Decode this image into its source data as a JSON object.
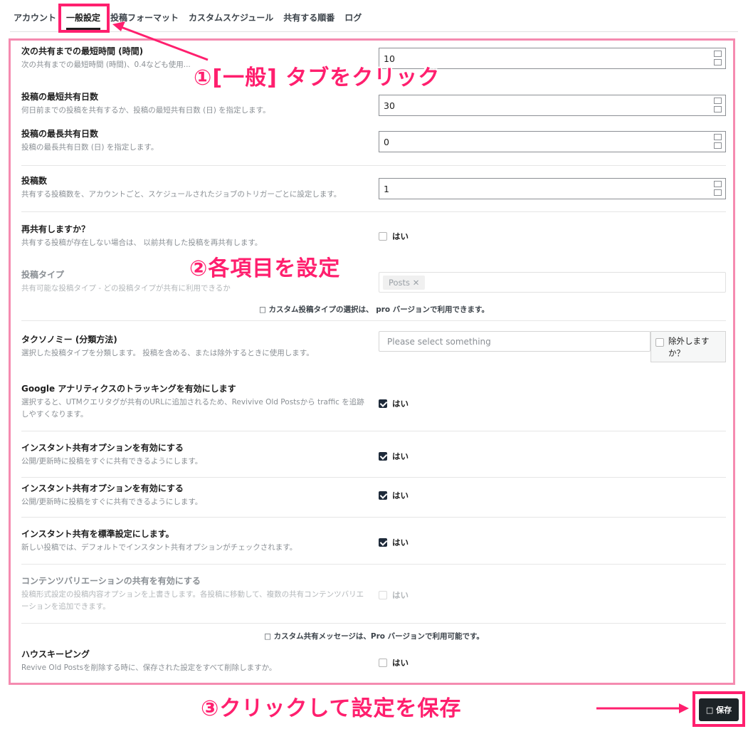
{
  "tabs": [
    {
      "label": "アカウント",
      "active": false
    },
    {
      "label": "一般設定",
      "active": true
    },
    {
      "label": "投稿フォーマット",
      "active": false
    },
    {
      "label": "カスタムスケジュール",
      "active": false
    },
    {
      "label": "共有する順番",
      "active": false
    },
    {
      "label": "ログ",
      "active": false
    }
  ],
  "annotations": {
    "step1": "①[一般] タブをクリック",
    "step2": "②各項目を設定",
    "step3": "③クリックして設定を保存",
    "color": "#ff1f6e",
    "frame_color": "#f58bb0"
  },
  "settings": {
    "min_interval": {
      "label": "次の共有までの最短時間 (時間)",
      "desc": "次の共有までの最短時間 (時間)、0.4なども使用...",
      "value": "10"
    },
    "min_age": {
      "label": "投稿の最短共有日数",
      "desc": "何日前までの投稿を共有するか、投稿の最短共有日数 (日) を指定します。",
      "value": "30"
    },
    "max_age": {
      "label": "投稿の最長共有日数",
      "desc": "投稿の最長共有日数 (日) を指定します。",
      "value": "0"
    },
    "post_count": {
      "label": "投稿数",
      "desc": "共有する投稿数を、アカウントごと、スケジュールされたジョブのトリガーごとに設定します。",
      "value": "1"
    },
    "reshare": {
      "label": "再共有しますか？",
      "desc": "共有する投稿が存在しない場合は、 以前共有した投稿を再共有します。",
      "option": "はい",
      "checked": false
    },
    "post_type": {
      "label": "投稿タイプ",
      "desc": "共有可能な投稿タイプ - どの投稿タイプが共有に利用できるか",
      "chip": "Posts ✕"
    },
    "post_type_note": "□ カスタム投稿タイプの選択は、 pro バージョンで利用できます。",
    "taxonomy": {
      "label": "タクソノミー (分類方法)",
      "desc": "選択した投稿タイプを分類します。 投稿を含める、または除外するときに使用します。",
      "placeholder": "Please select something",
      "exclude": "除外しますか？"
    },
    "ga_tracking": {
      "label": "Google アナリティクスのトラッキングを有効にします",
      "desc": "選択すると、UTMクエリタグが共有のURLに追加されるため、Revivive Old Postsから traffic を追跡しやすくなります。",
      "option": "はい",
      "checked": true
    },
    "instant_share_1": {
      "label": "インスタント共有オプションを有効にする",
      "desc": "公開/更新時に投稿をすぐに共有できるようにします。",
      "option": "はい",
      "checked": true
    },
    "instant_share_2": {
      "label": "インスタント共有オプションを有効にする",
      "desc": "公開/更新時に投稿をすぐに共有できるようにします。",
      "option": "はい",
      "checked": true
    },
    "instant_default": {
      "label": "インスタント共有を標準設定にします。",
      "desc": "新しい投稿では、デフォルトでインスタント共有オプションがチェックされます。",
      "option": "はい",
      "checked": true
    },
    "content_variation": {
      "label": "コンテンツバリエーションの共有を有効にする",
      "desc": "投稿形式設定の投稿内容オプションを上書きします。各投稿に移動して、複数の共有コンテンツバリエーションを追加できます。",
      "option": "はい",
      "checked": false
    },
    "custom_message_note": "□ カスタム共有メッセージは、Pro バージョンで利用可能です。",
    "housekeeping": {
      "label": "ハウスキーピング",
      "desc": "Revive Old Postsを削除する時に、保存された設定をすべて削除しますか。",
      "option": "はい",
      "checked": false
    }
  },
  "save_button": "□ 保存"
}
